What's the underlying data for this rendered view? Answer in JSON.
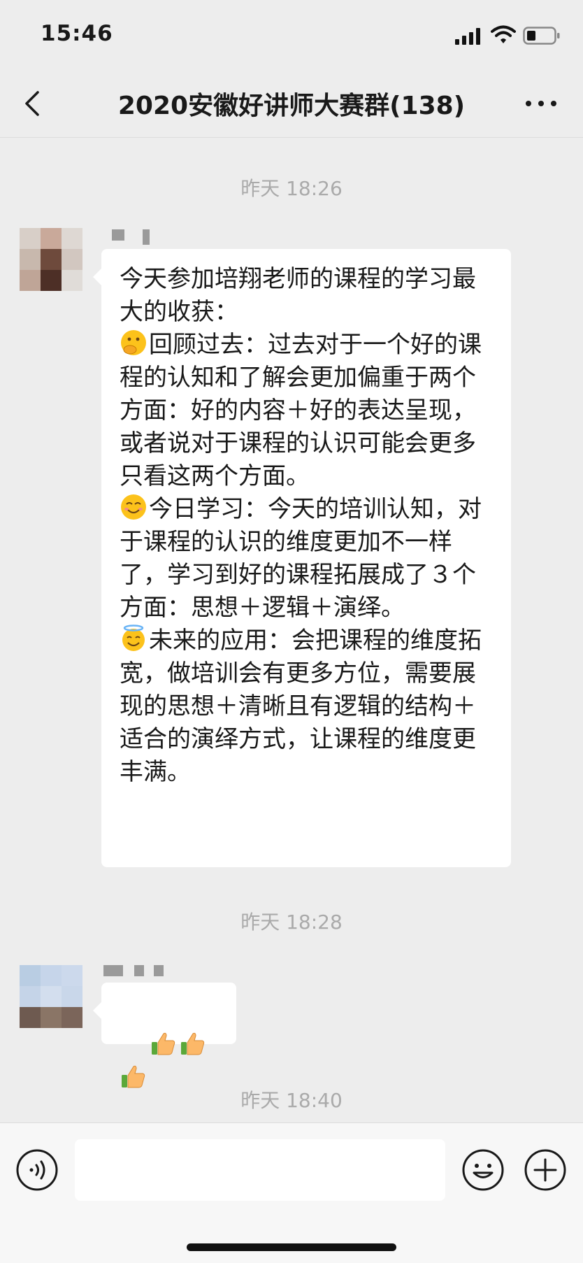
{
  "status_bar": {
    "time": "15:46"
  },
  "nav": {
    "title": "2020安徽好讲师大赛群(138)"
  },
  "timestamps": [
    "昨天 18:26",
    "昨天 18:28",
    "昨天 18:40"
  ],
  "messages": [
    {
      "text_intro": "今天参加培翔老师的课程的学习最大的收获：",
      "section1_emoji": "hand-over-mouth-emoji",
      "section1": "回顾过去：过去对于一个好的课程的认知和了解会更加偏重于两个方面：好的内容＋好的表达呈现，或者说对于课程的认识可能会更多只看这两个方面。",
      "section2_emoji": "smiling-emoji",
      "section2": "今日学习：今天的培训认知，对于课程的认识的维度更加不一样了，学习到好的课程拓展成了３个方面：思想＋逻辑＋演绎。",
      "section3_emoji": "halo-emoji",
      "section3": "未来的应用：会把课程的维度拓宽，做培训会有更多方位，需要展现的思想＋清晰且有逻辑的结构＋适合的演绎方式，让课程的维度更丰满。"
    },
    {
      "emoji_names": [
        "thumbs-up-emoji",
        "thumbs-up-emoji",
        "thumbs-up-emoji"
      ]
    }
  ],
  "input": {
    "placeholder": ""
  },
  "colors": {
    "background": "#ededed",
    "bubble": "#ffffff",
    "timestamp": "#aaaaaa"
  }
}
